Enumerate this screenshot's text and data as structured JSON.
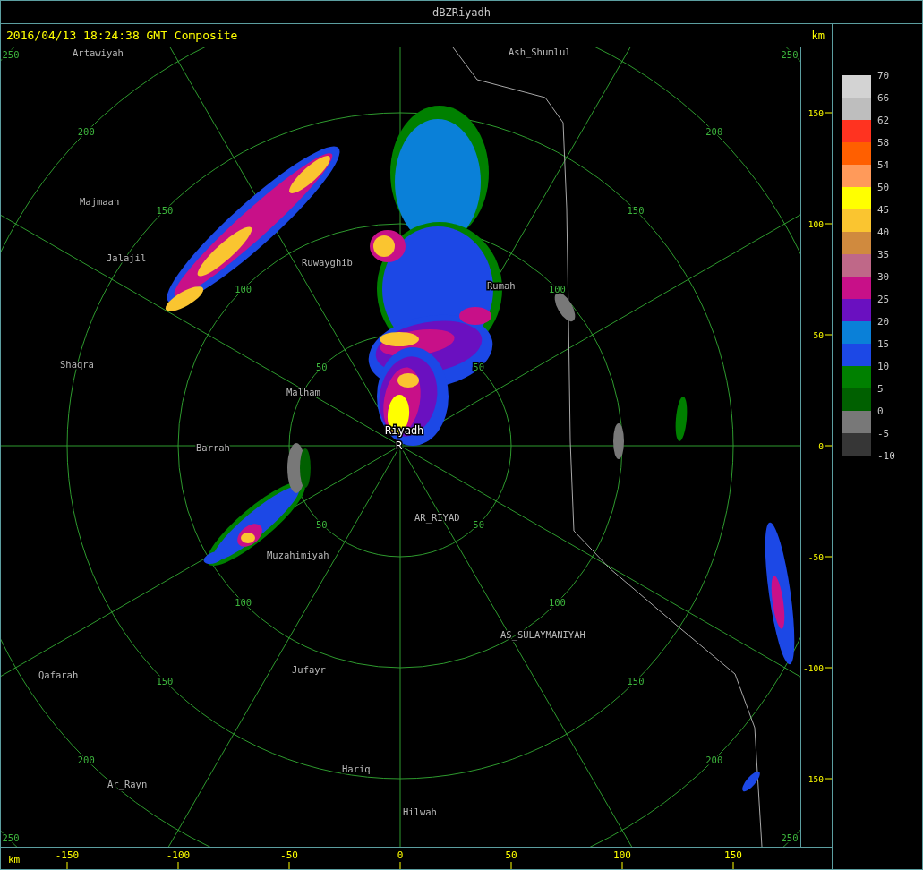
{
  "window": {
    "title": "dBZRiyadh"
  },
  "header": {
    "timestamp": "2016/04/13 18:24:38 GMT Composite",
    "unit": "km"
  },
  "map": {
    "places": [
      {
        "name": "Artawiyah",
        "kind": "town"
      },
      {
        "name": "Ash_Shumlul",
        "kind": "town"
      },
      {
        "name": "Majmaah",
        "kind": "town"
      },
      {
        "name": "Jalajil",
        "kind": "town"
      },
      {
        "name": "Ruwayghib",
        "kind": "town"
      },
      {
        "name": "Rumah",
        "kind": "town"
      },
      {
        "name": "Shaqra",
        "kind": "town"
      },
      {
        "name": "Malham",
        "kind": "town"
      },
      {
        "name": "Riyadh",
        "kind": "site"
      },
      {
        "name": "R",
        "kind": "site"
      },
      {
        "name": "Barrah",
        "kind": "town"
      },
      {
        "name": "AR_RIYAD",
        "kind": "town"
      },
      {
        "name": "Muzahimiyah",
        "kind": "town"
      },
      {
        "name": "AS_SULAYMANIYAH",
        "kind": "town"
      },
      {
        "name": "Qafarah",
        "kind": "town"
      },
      {
        "name": "Jufayr",
        "kind": "town"
      },
      {
        "name": "Ar_Rayn",
        "kind": "town"
      },
      {
        "name": "Hariq",
        "kind": "town"
      },
      {
        "name": "Hilwah",
        "kind": "town"
      }
    ],
    "range_rings": [
      {
        "labels": [
          "50",
          "50",
          "50",
          "50"
        ]
      },
      {
        "labels": [
          "100",
          "100",
          "100",
          "100"
        ]
      },
      {
        "labels": [
          "150",
          "150",
          "150",
          "150"
        ]
      },
      {
        "labels": [
          "200",
          "200",
          "200",
          "200"
        ]
      },
      {
        "labels": [
          "250",
          "250",
          "250",
          "250"
        ]
      }
    ]
  },
  "y_axis": {
    "ticks": [
      "150",
      "100",
      "50",
      "0",
      "-50",
      "-100",
      "-150"
    ]
  },
  "x_axis": {
    "unit": "km",
    "ticks": [
      "-150",
      "-100",
      "-50",
      "0",
      "50",
      "100",
      "150"
    ]
  },
  "legend": {
    "bins": [
      {
        "color": "#d3d3d3"
      },
      {
        "color": "#bebebe"
      },
      {
        "color": "#ff3320"
      },
      {
        "color": "#ff5f00"
      },
      {
        "color": "#ff9a5a"
      },
      {
        "color": "#ffff00"
      },
      {
        "color": "#fac530"
      },
      {
        "color": "#d08a3e"
      },
      {
        "color": "#bf6888"
      },
      {
        "color": "#c81088"
      },
      {
        "color": "#6a10c0"
      },
      {
        "color": "#0a80d8"
      },
      {
        "color": "#1c48e6"
      },
      {
        "color": "#008000"
      },
      {
        "color": "#006000"
      },
      {
        "color": "#787878"
      },
      {
        "color": "#363636"
      }
    ],
    "labels": [
      "70",
      "66",
      "62",
      "58",
      "54",
      "50",
      "45",
      "40",
      "35",
      "30",
      "25",
      "20",
      "15",
      "10",
      "5",
      "0",
      "-5",
      "-10"
    ]
  }
}
